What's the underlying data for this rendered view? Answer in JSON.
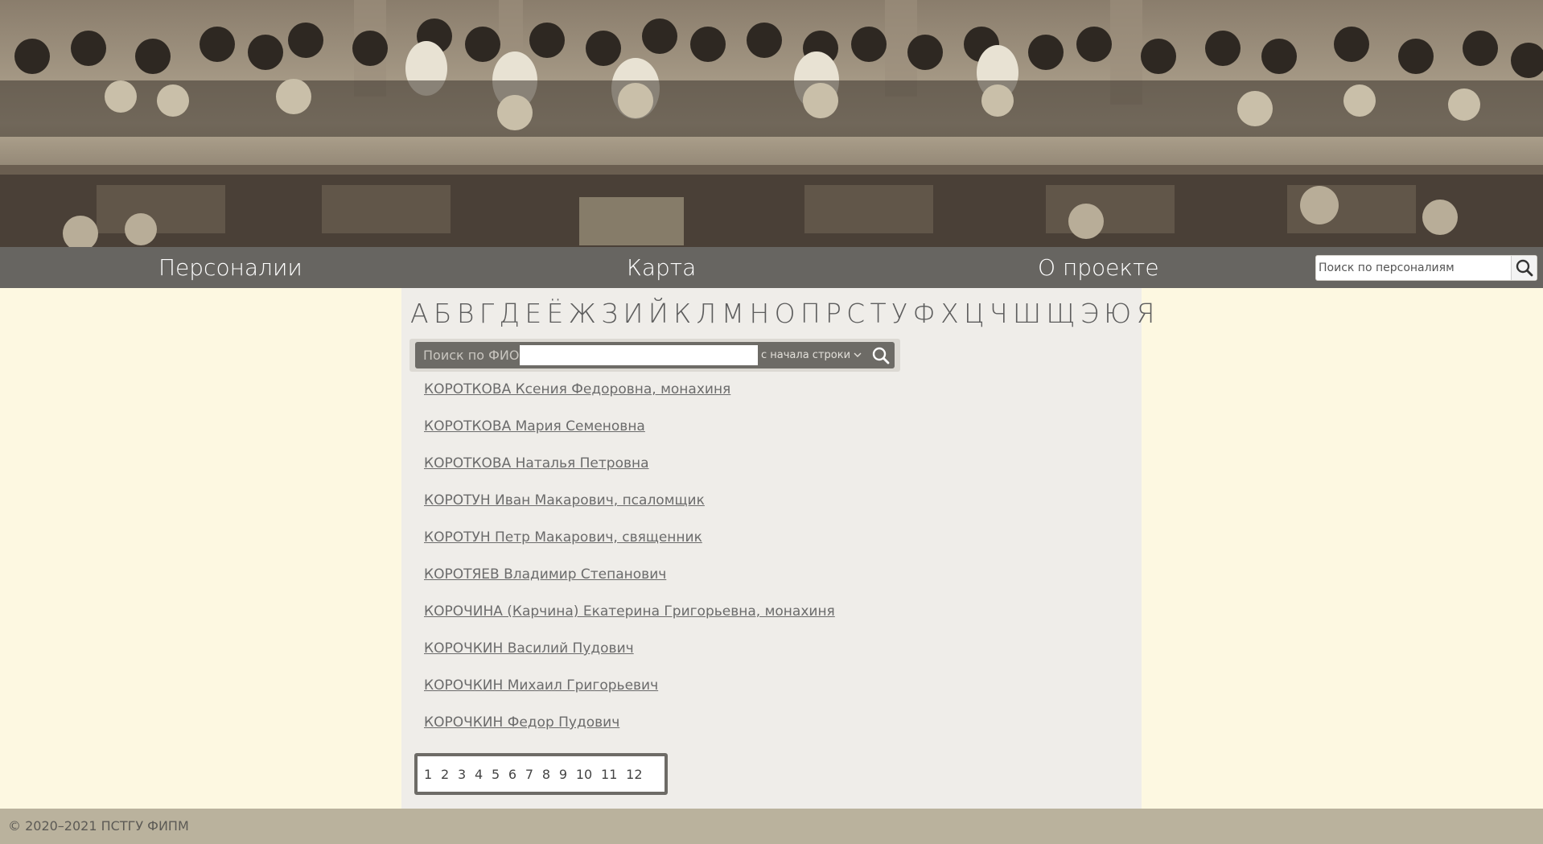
{
  "nav": {
    "personalii": "Персоналии",
    "map": "Карта",
    "about": "О проекте"
  },
  "global_search": {
    "placeholder": "Поиск по персоналиям"
  },
  "alphabet": [
    "А",
    "Б",
    "В",
    "Г",
    "Д",
    "Е",
    "Ё",
    "Ж",
    "З",
    "И",
    "Й",
    "К",
    "Л",
    "М",
    "Н",
    "О",
    "П",
    "Р",
    "С",
    "Т",
    "У",
    "Ф",
    "Х",
    "Ц",
    "Ч",
    "Ш",
    "Щ",
    "Э",
    "Ю",
    "Я"
  ],
  "fio_search": {
    "label": "Поиск по ФИО",
    "value": "",
    "mode": "с начала строки"
  },
  "persons": [
    "КОРОТКОВА Ксения Федоровна, монахиня",
    "КОРОТКОВА Мария Семеновна",
    "КОРОТКОВА Наталья Петровна",
    "КОРОТУН Иван Макарович, псаломщик",
    "КОРОТУН Петр Макарович, священник",
    "КОРОТЯЕВ Владимир Степанович",
    "КОРОЧИНА (Карчина) Екатерина Григорьевна, монахиня",
    "КОРОЧКИН Василий Пудович",
    "КОРОЧКИН Михаил Григорьевич",
    "КОРОЧКИН Федор Пудович"
  ],
  "pages": [
    "1",
    "2",
    "3",
    "4",
    "5",
    "6",
    "7",
    "8",
    "9",
    "10",
    "11",
    "12"
  ],
  "footer": {
    "copyright": "© 2020–2021 ПСТГУ ФИПМ"
  },
  "colors": {
    "page_bg": "#fdf8e1",
    "navbar": "#676561",
    "content_bg": "#efede9",
    "footer": "#bab29d"
  }
}
